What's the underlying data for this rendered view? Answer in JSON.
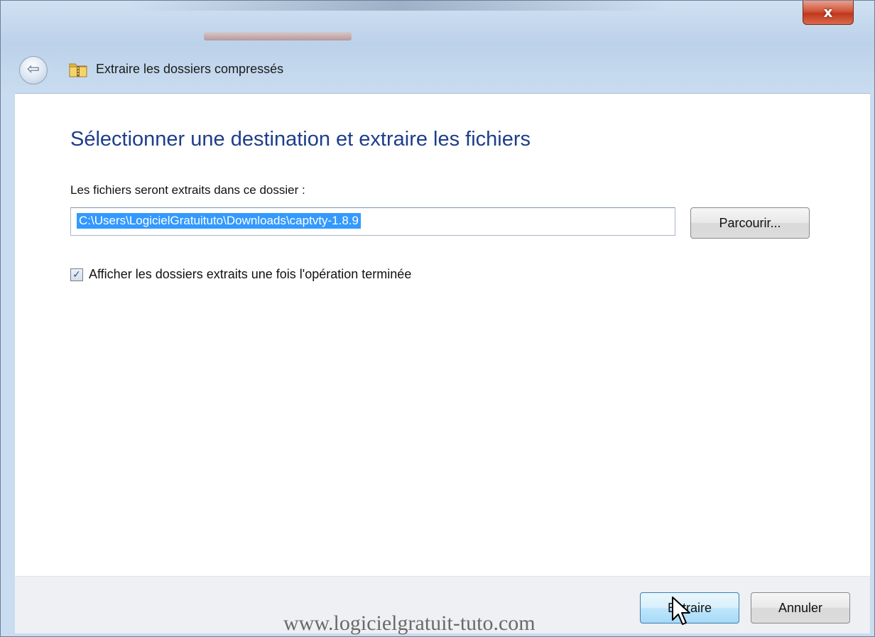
{
  "window": {
    "title": "Extraire les dossiers compressés",
    "close_glyph": "x",
    "back_glyph": "⇦",
    "icons": {
      "back": "back-arrow-icon",
      "folder": "zip-folder-icon",
      "close": "close-icon"
    }
  },
  "dialog": {
    "heading": "Sélectionner une destination et extraire les fichiers",
    "folder_label": "Les fichiers seront extraits dans ce dossier :",
    "destination_path": "C:\\Users\\LogicielGratuituto\\Downloads\\captvty-1.8.9",
    "browse_label": "Parcourir...",
    "show_folders_checkbox": {
      "checked": true,
      "check_glyph": "✓",
      "label": "Afficher les dossiers extraits une fois l'opération terminée"
    }
  },
  "footer": {
    "extract_label": "Extraire",
    "cancel_label": "Annuler"
  },
  "watermark": "www.logicielgratuit-tuto.com",
  "colors": {
    "heading": "#1e3e8a",
    "selection": "#3399ff",
    "close_button": "#c0391d",
    "title_bar": "#c9dcf0"
  }
}
